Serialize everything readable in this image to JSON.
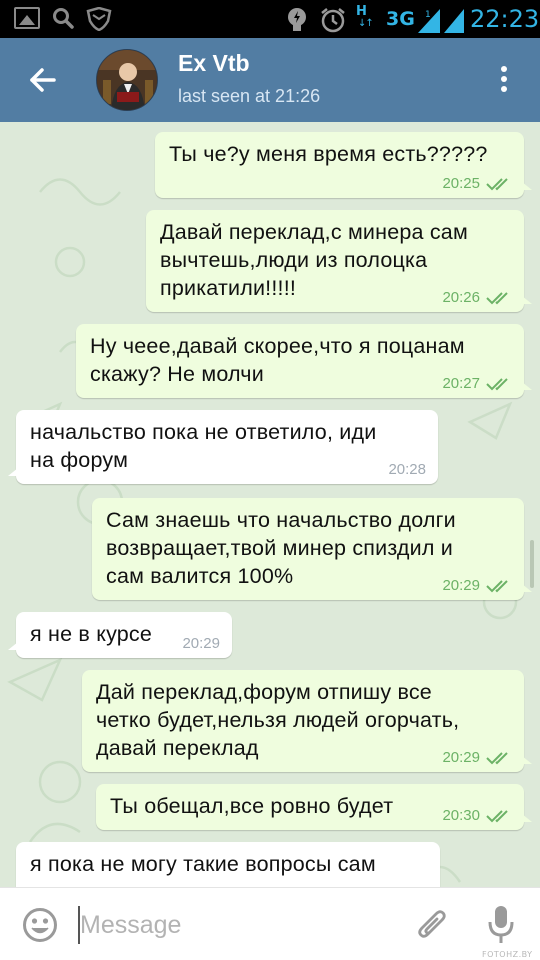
{
  "status_bar": {
    "network_letter": "H",
    "network_arrows": "↓↑",
    "network_type": "3G",
    "time": "22:23",
    "icons": [
      "gallery-icon",
      "search-icon",
      "shield-icon",
      "bulb-icon",
      "alarm-icon",
      "signal-icon",
      "signal-icon",
      "battery-icon"
    ]
  },
  "header": {
    "title": "Ex Vtb",
    "status": "last seen at 21:26",
    "icons": [
      "back-arrow-icon",
      "avatar",
      "more-vertical-icon"
    ]
  },
  "messages": [
    {
      "direction": "out",
      "lines": [
        "Ты че?у меня время есть?????"
      ],
      "time": "20:25",
      "read": true
    },
    {
      "direction": "out",
      "lines": [
        "Давай переклад,с минера сам",
        "вычтешь,люди из полоцка",
        "прикатили!!!!!"
      ],
      "time": "20:26",
      "read": true
    },
    {
      "direction": "out",
      "lines": [
        "Ну чеее,давай скорее,что я поцанам",
        "скажу? Не молчи"
      ],
      "time": "20:27",
      "read": true
    },
    {
      "direction": "in",
      "lines": [
        "начальство пока не ответило, иди",
        "на форум"
      ],
      "time": "20:28"
    },
    {
      "direction": "out",
      "lines": [
        "Сам знаешь что начальство долги",
        "возвращает,твой минер спиздил и",
        "сам валится 100%"
      ],
      "time": "20:29",
      "read": true
    },
    {
      "direction": "in",
      "lines": [
        "я не в курсе"
      ],
      "time": "20:29"
    },
    {
      "direction": "out",
      "lines": [
        "Дай переклад,форум отпишу все",
        "четко будет,нельзя людей огорчать,",
        "давай переклад"
      ],
      "time": "20:29",
      "read": true
    },
    {
      "direction": "out",
      "lines": [
        "Ты обещал,все ровно будет"
      ],
      "time": "20:30",
      "read": true
    },
    {
      "direction": "in",
      "lines": [
        "я пока не могу такие вопросы сам"
      ],
      "time": ""
    }
  ],
  "input": {
    "placeholder": "Message",
    "value": "",
    "icons": [
      "emoji-icon",
      "attach-icon",
      "mic-icon"
    ]
  },
  "watermark": "FOTOHZ.BY",
  "colors": {
    "header": "#527da3",
    "chat_background": "#dde9d9",
    "outgoing_bubble": "#effdde",
    "incoming_bubble": "#ffffff",
    "outgoing_meta": "#6cb266",
    "status_accent": "#33b5e5"
  }
}
